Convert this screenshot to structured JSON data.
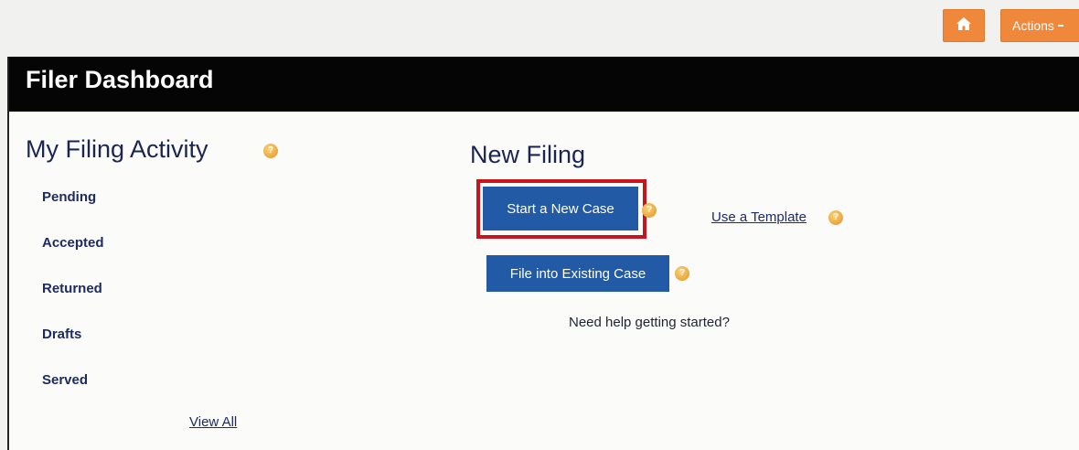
{
  "topbar": {
    "home_icon": "home-icon",
    "actions_label": "Actions",
    "accent_color": "#f0883c"
  },
  "panel": {
    "title": "Filer Dashboard"
  },
  "activity": {
    "title": "My Filing Activity",
    "items": [
      {
        "label": "Pending"
      },
      {
        "label": "Accepted"
      },
      {
        "label": "Returned"
      },
      {
        "label": "Drafts"
      },
      {
        "label": "Served"
      }
    ],
    "view_all_label": "View All"
  },
  "new_filing": {
    "title": "New Filing",
    "start_case_label": "Start a New Case",
    "existing_case_label": "File into Existing Case",
    "template_label": "Use a Template",
    "help_text": "Need help getting started?",
    "button_color": "#235aa6",
    "highlight_color": "#c8151d"
  }
}
